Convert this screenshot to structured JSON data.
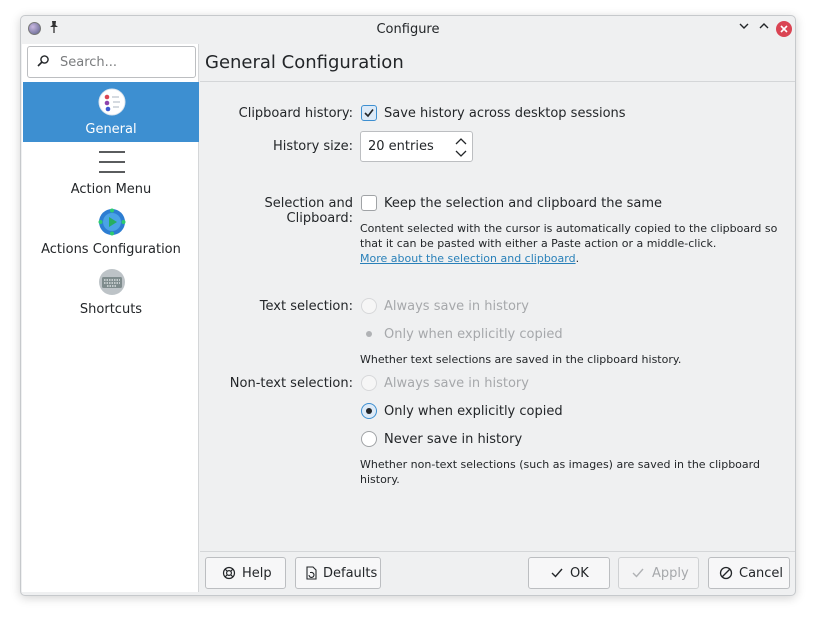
{
  "window": {
    "title": "Configure"
  },
  "search": {
    "placeholder": "Search..."
  },
  "sidebar": {
    "items": [
      {
        "label": "General",
        "icon": "clipboard-icon",
        "active": true
      },
      {
        "label": "Action Menu",
        "icon": "hamburger-menu-icon",
        "active": false
      },
      {
        "label": "Actions Configuration",
        "icon": "actions-gear-icon",
        "active": false
      },
      {
        "label": "Shortcuts",
        "icon": "keyboard-icon",
        "active": false
      }
    ]
  },
  "main": {
    "title": "General Configuration",
    "clipboard_history": {
      "label": "Clipboard history:",
      "option": "Save history across desktop sessions",
      "checked": true
    },
    "history_size": {
      "label": "History size:",
      "value": "20 entries"
    },
    "selection_clipboard": {
      "label": "Selection and Clipboard:",
      "option": "Keep the selection and clipboard the same",
      "checked": false,
      "note_line1": "Content selected with the cursor is automatically copied to the clipboard so",
      "note_line2": "that it can be pasted with either a Paste action or a middle-click.",
      "link": "More about the selection and clipboard",
      "link_suffix": "."
    },
    "text_selection": {
      "label": "Text selection:",
      "options": [
        "Always save in history",
        "Only when explicitly copied"
      ],
      "selected": 1,
      "enabled": false,
      "note": "Whether text selections are saved in the clipboard history."
    },
    "non_text_selection": {
      "label": "Non-text selection:",
      "options": [
        "Always save in history",
        "Only when explicitly copied",
        "Never save in history"
      ],
      "selected": 1,
      "note_line1": "Whether non-text selections (such as images) are saved in the clipboard",
      "note_line2": "history."
    }
  },
  "footer": {
    "help": "Help",
    "defaults": "Defaults",
    "ok": "OK",
    "apply": "Apply",
    "cancel": "Cancel"
  },
  "colors": {
    "accent": "#3d8fd1",
    "close": "#da4453",
    "link": "#2980b9"
  }
}
